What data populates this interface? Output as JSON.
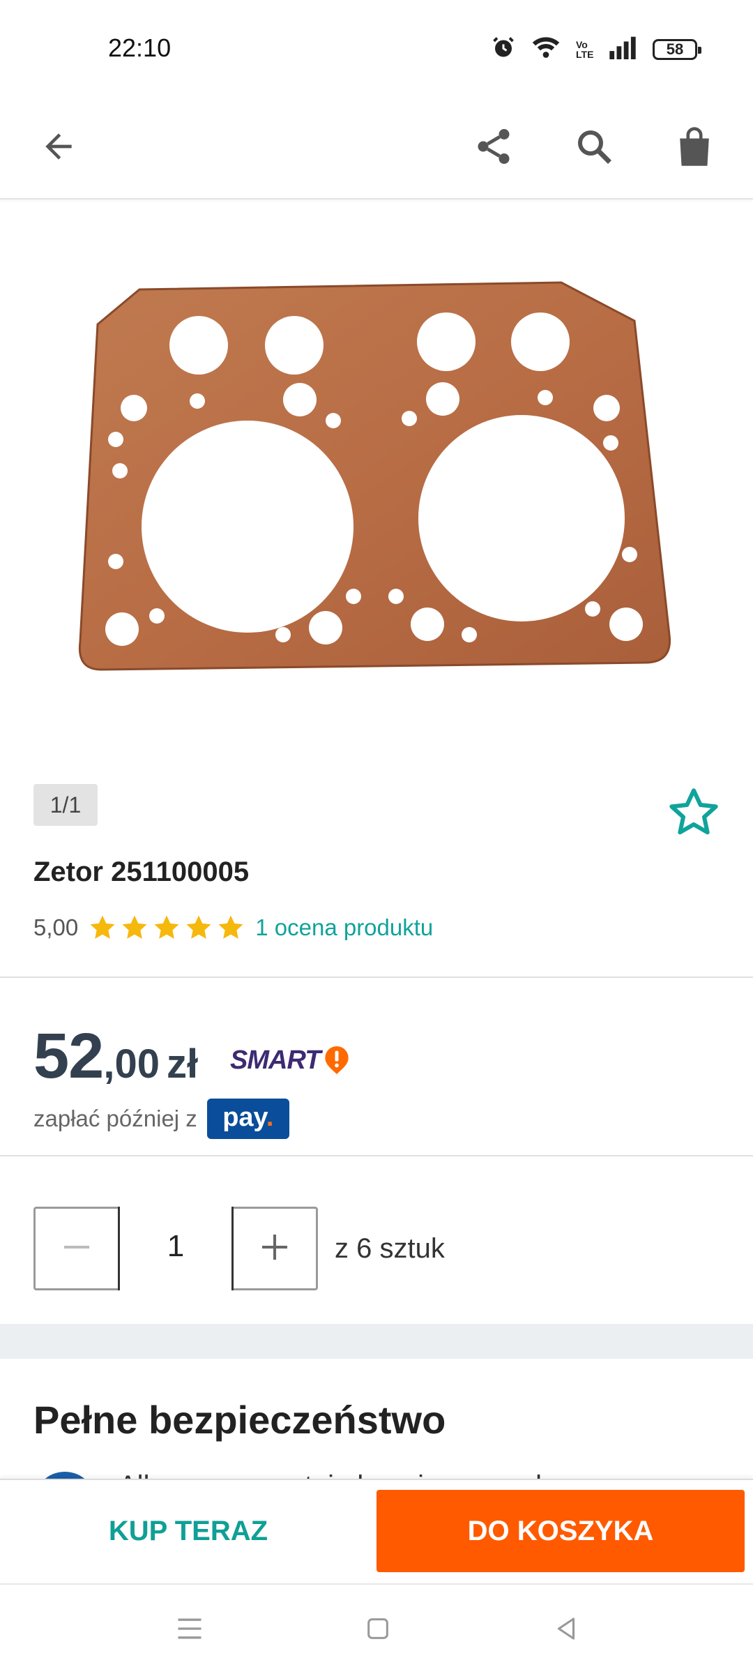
{
  "status_bar": {
    "time": "22:10",
    "battery": "58",
    "network_label": "Vo LTE"
  },
  "app_bar": {
    "icons": [
      "back-arrow-icon",
      "share-icon",
      "search-icon",
      "shopping-bag-icon"
    ]
  },
  "gallery": {
    "page_indicator": "1/1",
    "image": "cylinder-head-gasket"
  },
  "product": {
    "title": "Zetor 251100005",
    "rating_value": "5,00",
    "stars": 5,
    "rating_link": "1 ocena produktu"
  },
  "price": {
    "integer": "52",
    "decimal": ",00",
    "currency": "zł",
    "smart_label": "SMART",
    "pay_later": "zapłać później z",
    "pay_logo": "pay",
    "pay_logo_dot": "."
  },
  "quantity": {
    "value": "1",
    "of_label": "z 6 sztuk"
  },
  "safety": {
    "title": "Pełne bezpieczeństwo",
    "peek_text": "Allegro gwarantuje bezpieczne zakupy"
  },
  "actions": {
    "buy_now": "KUP TERAZ",
    "add_to_cart": "DO KOSZYKA"
  },
  "colors": {
    "accent_teal": "#10a39b",
    "cta_orange": "#ff5a00",
    "star_yellow": "#f6b80c",
    "price_dark": "#33404f",
    "smart_purple": "#3d2a73"
  }
}
